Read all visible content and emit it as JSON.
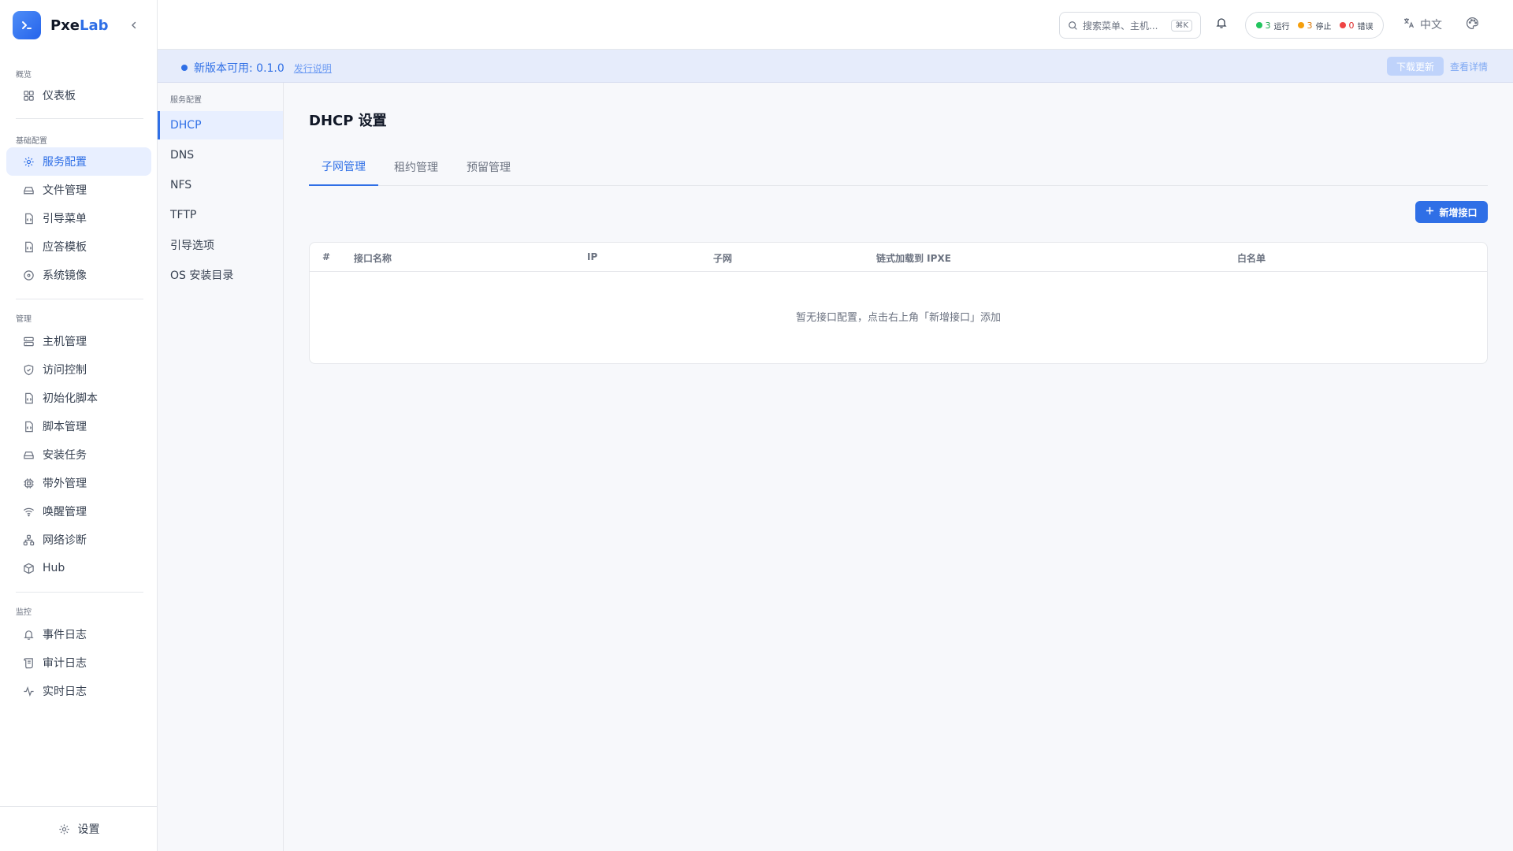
{
  "brand": {
    "name_prefix": "Pxe",
    "name_accent": "Lab"
  },
  "sidebar": {
    "sections": [
      {
        "title": "概览",
        "items": [
          {
            "label": "仪表板",
            "icon": "grid-icon"
          }
        ]
      },
      {
        "title": "基础配置",
        "items": [
          {
            "label": "服务配置",
            "icon": "gear-icon",
            "active": true
          },
          {
            "label": "文件管理",
            "icon": "drive-icon"
          },
          {
            "label": "引导菜单",
            "icon": "file-code-icon"
          },
          {
            "label": "应答模板",
            "icon": "file-code-icon"
          },
          {
            "label": "系统镜像",
            "icon": "disc-icon"
          }
        ]
      },
      {
        "title": "管理",
        "items": [
          {
            "label": "主机管理",
            "icon": "server-icon"
          },
          {
            "label": "访问控制",
            "icon": "shield-icon"
          },
          {
            "label": "初始化脚本",
            "icon": "file-code-icon"
          },
          {
            "label": "脚本管理",
            "icon": "file-code-icon"
          },
          {
            "label": "安装任务",
            "icon": "drive-icon"
          },
          {
            "label": "带外管理",
            "icon": "chip-icon"
          },
          {
            "label": "唤醒管理",
            "icon": "wifi-icon"
          },
          {
            "label": "网络诊断",
            "icon": "network-icon"
          },
          {
            "label": "Hub",
            "icon": "cube-icon"
          }
        ]
      },
      {
        "title": "监控",
        "items": [
          {
            "label": "事件日志",
            "icon": "bell-icon"
          },
          {
            "label": "审计日志",
            "icon": "scroll-icon"
          },
          {
            "label": "实时日志",
            "icon": "activity-icon"
          }
        ]
      }
    ],
    "footer_label": "设置"
  },
  "header": {
    "search_placeholder": "搜索菜单、主机...",
    "search_shortcut": "⌘K",
    "status": {
      "running": {
        "count": "3",
        "label": "运行",
        "color": "#22c55e"
      },
      "stopped": {
        "count": "3",
        "label": "停止",
        "color": "#f59e0b"
      },
      "error": {
        "count": "0",
        "label": "错误",
        "color": "#ef4444"
      }
    },
    "language": "中文"
  },
  "banner": {
    "text": "新版本可用: 0.1.0",
    "release_notes": "发行说明",
    "download": "下载更新",
    "details": "查看详情"
  },
  "subnav": {
    "title": "服务配置",
    "items": [
      {
        "label": "DHCP",
        "active": true
      },
      {
        "label": "DNS"
      },
      {
        "label": "NFS"
      },
      {
        "label": "TFTP"
      },
      {
        "label": "引导选项"
      },
      {
        "label": "OS 安装目录"
      }
    ]
  },
  "main": {
    "title": "DHCP 设置",
    "tabs": [
      {
        "label": "子网管理",
        "active": true
      },
      {
        "label": "租约管理"
      },
      {
        "label": "预留管理"
      }
    ],
    "add_button": "新增接口",
    "table": {
      "columns": [
        "#",
        "接口名称",
        "IP",
        "子网",
        "链式加载到 IPXE",
        "白名单"
      ],
      "empty_text": "暂无接口配置，点击右上角「新增接口」添加"
    }
  },
  "colors": {
    "accent": "#2f6fe6",
    "accent_light": "#e8efff"
  }
}
